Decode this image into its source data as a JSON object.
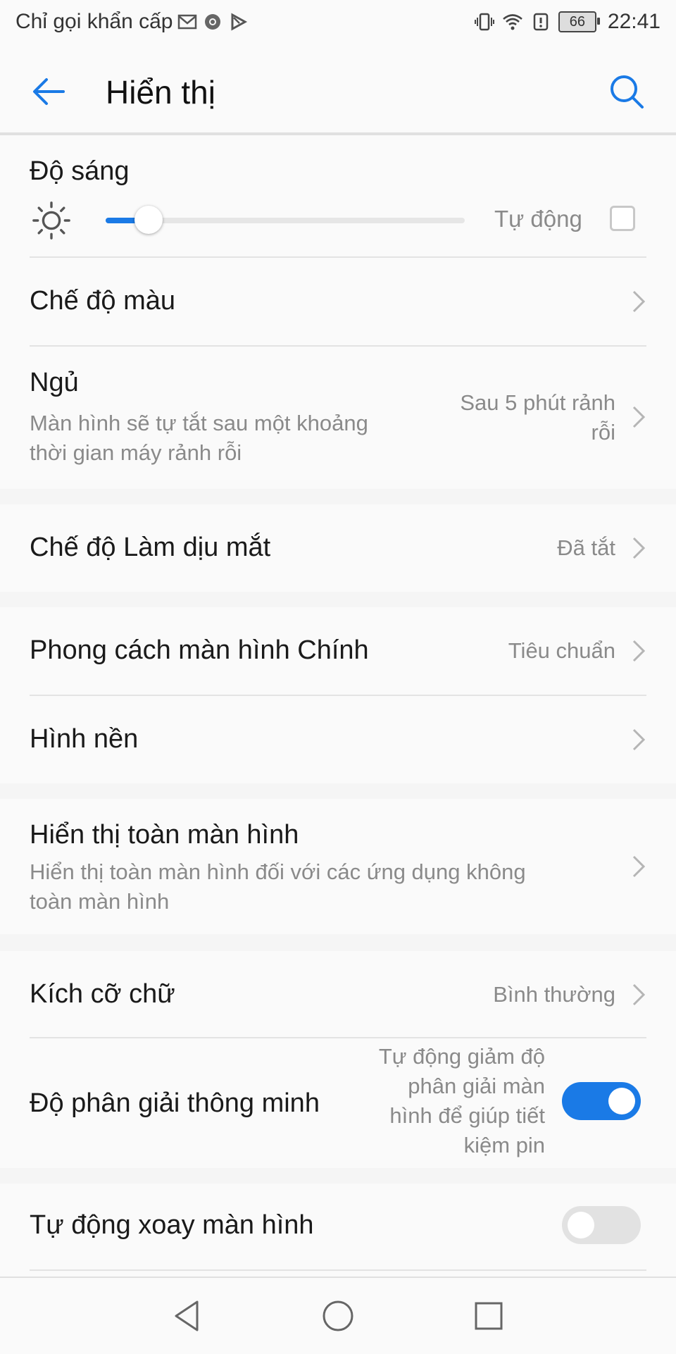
{
  "status_bar": {
    "carrier": "Chỉ gọi khẩn cấp",
    "battery": "66",
    "time": "22:41",
    "left_icons": [
      "gmail-icon",
      "chrome-icon",
      "play-store-icon"
    ],
    "right_icons": [
      "vibrate-icon",
      "wifi-icon",
      "alert-icon",
      "battery-icon"
    ]
  },
  "app_bar": {
    "title": "Hiển thị",
    "back_icon": "arrow-left-icon",
    "search_icon": "search-icon",
    "accent": "#1a7ae6"
  },
  "brightness": {
    "title": "Độ sáng",
    "icon": "sun-icon",
    "level_fraction": 0.12,
    "auto_label": "Tự động",
    "auto_checked": false
  },
  "color_mode": {
    "label": "Chế độ màu"
  },
  "sleep": {
    "label": "Ngủ",
    "sub_line1": "Màn hình sẽ tự tắt sau một khoảng",
    "sub_line2": "thời gian máy rảnh rỗi",
    "value_line1": "Sau 5 phút rảnh",
    "value_line2": "rỗi"
  },
  "eye_comfort": {
    "label": "Chế độ Làm dịu mắt",
    "value": "Đã tắt"
  },
  "home_style": {
    "label": "Phong cách màn hình Chính",
    "value": "Tiêu chuẩn"
  },
  "wallpaper": {
    "label": "Hình nền"
  },
  "full_screen": {
    "label": "Hiển thị toàn màn hình",
    "sub_line1": "Hiển thị toàn màn hình đối với các ứng dụng không",
    "sub_line2": "toàn màn hình"
  },
  "font_size": {
    "label": "Kích cỡ chữ",
    "value": "Bình thường"
  },
  "smart_resolution": {
    "label": "Độ phân giải thông minh",
    "desc_line1": "Tự động giảm độ",
    "desc_line2": "phân giải màn",
    "desc_line3": "hình để giúp tiết",
    "desc_line4": "kiệm pin",
    "enabled": true
  },
  "auto_rotate": {
    "label": "Tự động xoay màn hình",
    "enabled": false
  },
  "nav_bar": {
    "back_icon": "nav-back-triangle-icon",
    "home_icon": "nav-home-circle-icon",
    "recents_icon": "nav-recents-square-icon"
  }
}
